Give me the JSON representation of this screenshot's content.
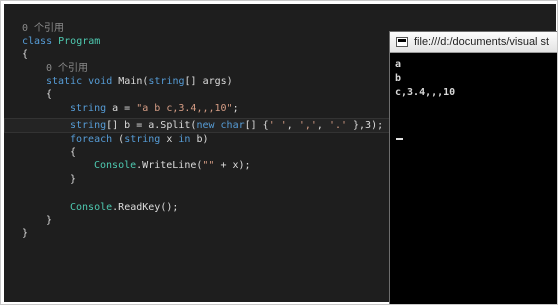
{
  "editor": {
    "l1_ref": "0 个引用",
    "l2_kw": "class",
    "l2_type": "Program",
    "l3": "{",
    "l4_ref": "0 个引用",
    "l5_kw1": "static",
    "l5_kw2": "void",
    "l5_name": "Main(",
    "l5_kw3": "string",
    "l5_rest": "[] args)",
    "l6": "{",
    "l7_kw": "string",
    "l7_mid": " a = ",
    "l7_str": "\"a b c,3.4,,,10\"",
    "l7_end": ";",
    "l8_kw": "string",
    "l8_a": "[] b = a.Split(",
    "l8_kw2": "new",
    "l8_kw3": "char",
    "l8_b": "[] {",
    "l8_s1": "' '",
    "l8_c1": ", ",
    "l8_s2": "','",
    "l8_c2": ", ",
    "l8_s3": "'.'",
    "l8_end": " },3);",
    "l9_kw": "foreach",
    "l9_a": " (",
    "l9_kw2": "string",
    "l9_b": " x ",
    "l9_kw3": "in",
    "l9_c": " b)",
    "l10": "{",
    "l11_type": "Console",
    "l11_a": ".WriteLine(",
    "l11_str": "\"\"",
    "l11_b": " + x);",
    "l12": "}",
    "l13_type": "Console",
    "l13_a": ".ReadKey();",
    "l14": "}",
    "l15": "}"
  },
  "console": {
    "title": "file:///d:/documents/visual st",
    "output": [
      "a",
      "b",
      "c,3.4,,,10"
    ]
  }
}
